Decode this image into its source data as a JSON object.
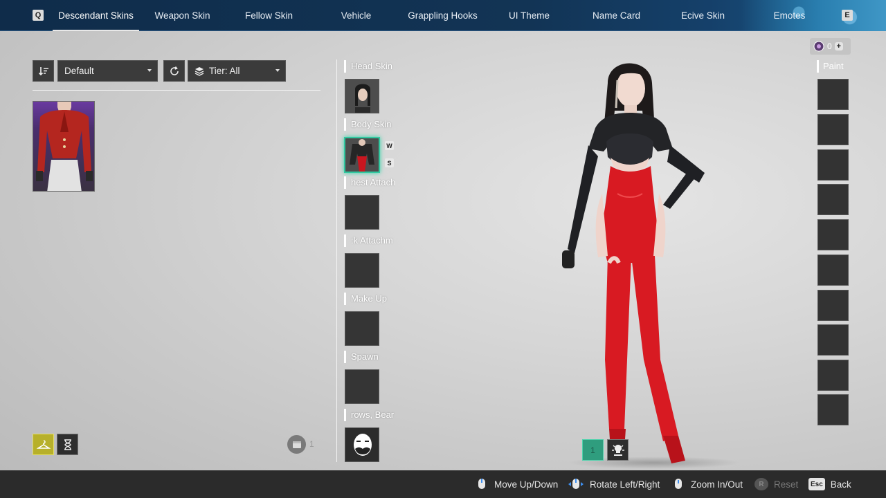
{
  "topnav": {
    "left_key": "Q",
    "right_key": "E",
    "tabs": [
      {
        "label": "Descendant Skins",
        "active": true
      },
      {
        "label": "Weapon Skin"
      },
      {
        "label": "Fellow Skin"
      },
      {
        "label": "Vehicle"
      },
      {
        "label": "Grappling Hooks"
      },
      {
        "label": "UI Theme"
      },
      {
        "label": "Name Card"
      },
      {
        "label": "Ecive Skin"
      },
      {
        "label": "Emotes"
      }
    ]
  },
  "filters": {
    "sort_value": "Default",
    "tier_value": "Tier: All"
  },
  "inventory": {
    "count": "1"
  },
  "slots": [
    {
      "label": "Head Skin"
    },
    {
      "label": "Body Skin",
      "tags": [
        "W",
        "S"
      ]
    },
    {
      "label": "hest Attach"
    },
    {
      "label": ":k Attachm"
    },
    {
      "label": "Make Up"
    },
    {
      "label": "Spawn"
    },
    {
      "label": "rows, Bear"
    }
  ],
  "vehicle_buttons": {
    "first_label": "1"
  },
  "paint": {
    "label": "Paint",
    "currency_value": "0"
  },
  "hints": {
    "move": "Move Up/Down",
    "rotate": "Rotate Left/Right",
    "zoom": "Zoom In/Out",
    "reset_key": "R",
    "reset": "Reset",
    "esc_key": "Esc",
    "back": "Back"
  },
  "colors": {
    "accent_teal": "#31c8a0",
    "suit_red": "#d81a22",
    "nav_blue": "#123455"
  }
}
